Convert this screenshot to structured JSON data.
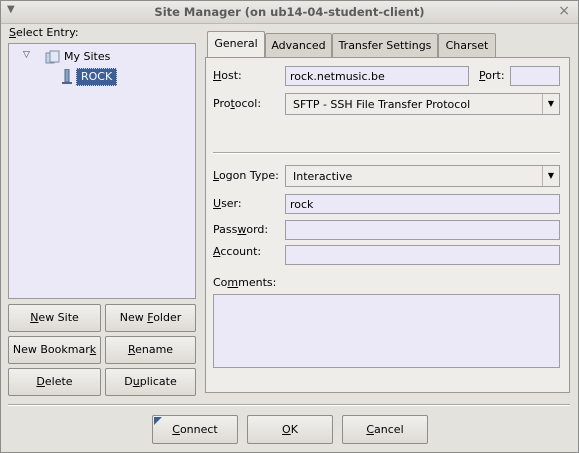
{
  "window": {
    "title": "Site Manager (on ub14-04-student-client)"
  },
  "left": {
    "select_entry_label": "Select Entry:",
    "tree": [
      {
        "label": "My Sites",
        "expanded": true,
        "icon": "folder-icon"
      },
      {
        "label": "ROCK",
        "selected": true,
        "icon": "server-icon"
      }
    ],
    "buttons": {
      "new_site": "New Site",
      "new_folder": "New Folder",
      "new_bookmark": "New Bookmark",
      "rename": "Rename",
      "delete": "Delete",
      "duplicate": "Duplicate"
    }
  },
  "tabs": [
    "General",
    "Advanced",
    "Transfer Settings",
    "Charset"
  ],
  "active_tab": "General",
  "general": {
    "host_label": "Host:",
    "host_value": "rock.netmusic.be",
    "port_label": "Port:",
    "port_value": "",
    "protocol_label": "Protocol:",
    "protocol_value": "SFTP - SSH File Transfer Protocol",
    "logon_type_label": "Logon Type:",
    "logon_type_value": "Interactive",
    "user_label": "User:",
    "user_value": "rock",
    "password_label": "Password:",
    "password_value": "",
    "account_label": "Account:",
    "account_value": "",
    "comments_label": "Comments:",
    "comments_value": ""
  },
  "footer": {
    "connect": "Connect",
    "ok": "OK",
    "cancel": "Cancel"
  },
  "colors": {
    "selection_bg": "#3d5f95",
    "input_bg": "#ebe9f7"
  }
}
